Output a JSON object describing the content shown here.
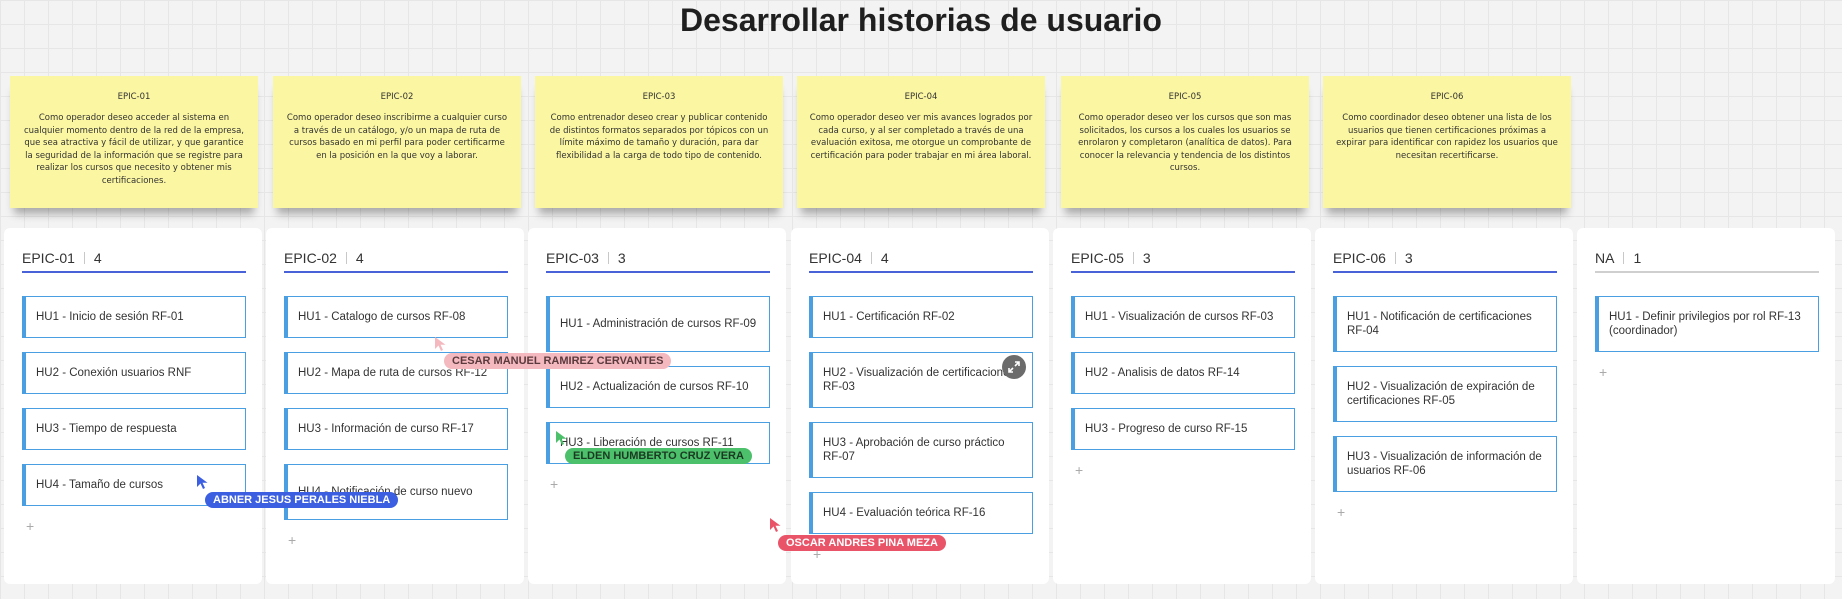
{
  "board": {
    "title": "Desarrollar historias de usuario"
  },
  "stickies": [
    {
      "title": "EPIC-01",
      "text": "Como operador deseo acceder al sistema en cualquier momento dentro de la red de la empresa, que sea atractiva y fácil de utilizar, y que garantice la seguridad de la información que se registre para realizar los cursos que necesito y obtener mis certificaciones."
    },
    {
      "title": "EPIC-02",
      "text": "Como operador deseo inscribirme a cualquier curso a través de un catálogo, y/o un mapa de ruta de cursos basado en mi perfil para poder certificarme en la posición en la que voy a laborar."
    },
    {
      "title": "EPIC-03",
      "text": "Como entrenador deseo crear y publicar contenido de distintos  formatos separados por tópicos con un límite máximo de tamaño y duración, para dar flexibilidad a la carga de todo tipo de contenido."
    },
    {
      "title": "EPIC-04",
      "text": "Como operador deseo ver mis avances logrados por cada curso, y al ser completado a través de una evaluación exitosa, me otorgue un comprobante de certificación para poder trabajar en mi área laboral."
    },
    {
      "title": "EPIC-05",
      "text": "Como operador deseo ver los cursos que son mas solicitados, los cursos a los cuales los usuarios se enrolaron y completaron (analítica de datos). Para conocer la relevancia y tendencia de los distintos cursos."
    },
    {
      "title": "EPIC-06",
      "text": "Como coordinador deseo obtener una lista de los usuarios que tienen certificaciones próximas a expirar para identificar con rapidez los usuarios que necesitan recertificarse."
    }
  ],
  "columns": [
    {
      "name": "EPIC-01",
      "count": "4",
      "add": "+",
      "cards": [
        "HU1 - Inicio de sesión RF-01",
        "HU2 - Conexión usuarios RNF",
        "HU3 - Tiempo de respuesta",
        "HU4 - Tamaño de cursos"
      ]
    },
    {
      "name": "EPIC-02",
      "count": "4",
      "add": "+",
      "cards": [
        "HU1 - Catalogo de cursos RF-08",
        "HU2 - Mapa de ruta de cursos RF-12",
        "HU3 - Información de curso RF-17",
        "HU4 - Notificación de curso nuevo"
      ]
    },
    {
      "name": "EPIC-03",
      "count": "3",
      "add": "+",
      "cards": [
        "HU1 - Administración de cursos RF-09",
        "HU2 - Actualización de cursos RF-10",
        "HU3 - Liberación de cursos RF-11"
      ]
    },
    {
      "name": "EPIC-04",
      "count": "4",
      "add": "+",
      "cards": [
        "HU1 - Certificación RF-02",
        "HU2 - Visualización de certificaciones RF-03",
        "HU3 - Aprobación de curso práctico RF-07",
        "HU4 - Evaluación teórica RF-16"
      ]
    },
    {
      "name": "EPIC-05",
      "count": "3",
      "add": "+",
      "cards": [
        "HU1 - Visualización de cursos RF-03",
        "HU2 - Analisis de datos RF-14",
        "HU3 - Progreso de curso RF-15"
      ]
    },
    {
      "name": "EPIC-06",
      "count": "3",
      "add": "+",
      "cards": [
        "HU1 - Notificación de certificaciones RF-04",
        "HU2 - Visualización de expiración de certificaciones RF-05",
        "HU3 - Visualización de información de usuarios RF-06"
      ]
    },
    {
      "name": "NA",
      "count": "1",
      "add": "+",
      "cards": [
        "HU1 - Definir privilegios por rol RF-13 (coordinador)"
      ]
    }
  ],
  "cursors": [
    {
      "name": "CESAR MANUEL RAMIREZ CERVANTES",
      "color": "#f4b8bf",
      "text_color": "#5a3a3d"
    },
    {
      "name": "ELDEN HUMBERTO CRUZ VERA",
      "color": "#4cc06a",
      "text_color": "#1b3a22"
    },
    {
      "name": "ABNER JESUS PERALES NIEBLA",
      "color": "#3b5fe0",
      "text_color": "#ffffff"
    },
    {
      "name": "OSCAR ANDRES PINA MEZA",
      "color": "#ea5468",
      "text_color": "#ffffff"
    }
  ]
}
